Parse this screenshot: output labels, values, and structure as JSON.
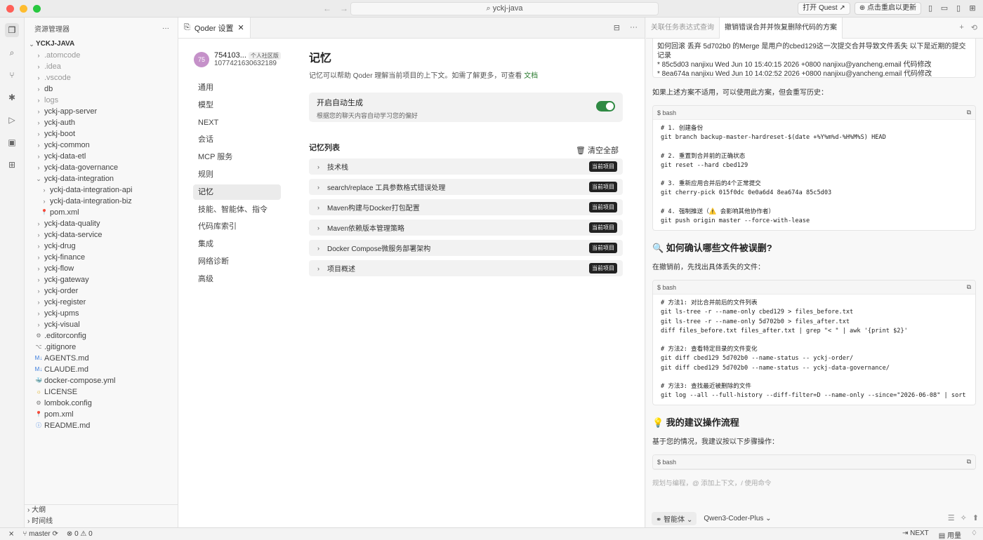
{
  "window": {
    "title": "yckj-java"
  },
  "titlebar": {
    "open_quest": "打开 Quest",
    "restart_update": "点击重启以更新"
  },
  "explorer": {
    "header": "资源管理器",
    "more": "···",
    "root": "YCKJ-JAVA",
    "items": [
      {
        "label": ".atomcode",
        "kind": "folder",
        "depth": 1,
        "dim": true
      },
      {
        "label": ".idea",
        "kind": "folder",
        "depth": 1,
        "dim": true
      },
      {
        "label": ".vscode",
        "kind": "folder",
        "depth": 1,
        "dim": true
      },
      {
        "label": "db",
        "kind": "folder",
        "depth": 1,
        "dim": false
      },
      {
        "label": "logs",
        "kind": "folder",
        "depth": 1,
        "dim": true
      },
      {
        "label": "yckj-app-server",
        "kind": "folder",
        "depth": 1,
        "dim": false
      },
      {
        "label": "yckj-auth",
        "kind": "folder",
        "depth": 1,
        "dim": false
      },
      {
        "label": "yckj-boot",
        "kind": "folder",
        "depth": 1,
        "dim": false
      },
      {
        "label": "yckj-common",
        "kind": "folder",
        "depth": 1,
        "dim": false
      },
      {
        "label": "yckj-data-etl",
        "kind": "folder",
        "depth": 1,
        "dim": false
      },
      {
        "label": "yckj-data-governance",
        "kind": "folder",
        "depth": 1,
        "dim": false
      },
      {
        "label": "yckj-data-integration",
        "kind": "folder-open",
        "depth": 1,
        "dim": false
      },
      {
        "label": "yckj-data-integration-api",
        "kind": "folder",
        "depth": 2,
        "dim": false
      },
      {
        "label": "yckj-data-integration-biz",
        "kind": "folder",
        "depth": 2,
        "dim": false
      },
      {
        "label": "pom.xml",
        "kind": "maven",
        "depth": 2,
        "dim": false
      },
      {
        "label": "yckj-data-quality",
        "kind": "folder",
        "depth": 1,
        "dim": false
      },
      {
        "label": "yckj-data-service",
        "kind": "folder",
        "depth": 1,
        "dim": false
      },
      {
        "label": "yckj-drug",
        "kind": "folder",
        "depth": 1,
        "dim": false
      },
      {
        "label": "yckj-finance",
        "kind": "folder",
        "depth": 1,
        "dim": false
      },
      {
        "label": "yckj-flow",
        "kind": "folder",
        "depth": 1,
        "dim": false
      },
      {
        "label": "yckj-gateway",
        "kind": "folder",
        "depth": 1,
        "dim": false
      },
      {
        "label": "yckj-order",
        "kind": "folder",
        "depth": 1,
        "dim": false
      },
      {
        "label": "yckj-register",
        "kind": "folder",
        "depth": 1,
        "dim": false
      },
      {
        "label": "yckj-upms",
        "kind": "folder",
        "depth": 1,
        "dim": false
      },
      {
        "label": "yckj-visual",
        "kind": "folder",
        "depth": 1,
        "dim": false
      },
      {
        "label": ".editorconfig",
        "kind": "gear",
        "depth": 1,
        "dim": false
      },
      {
        "label": ".gitignore",
        "kind": "git",
        "depth": 1,
        "dim": false
      },
      {
        "label": "AGENTS.md",
        "kind": "md",
        "depth": 1,
        "dim": false
      },
      {
        "label": "CLAUDE.md",
        "kind": "md",
        "depth": 1,
        "dim": false
      },
      {
        "label": "docker-compose.yml",
        "kind": "docker",
        "depth": 1,
        "dim": false
      },
      {
        "label": "LICENSE",
        "kind": "license",
        "depth": 1,
        "dim": false
      },
      {
        "label": "lombok.config",
        "kind": "gear",
        "depth": 1,
        "dim": false
      },
      {
        "label": "pom.xml",
        "kind": "maven",
        "depth": 1,
        "dim": false
      },
      {
        "label": "README.md",
        "kind": "info",
        "depth": 1,
        "dim": false
      }
    ],
    "outline": "大纲",
    "timeline": "时间线"
  },
  "editor": {
    "tab_label": "Qoder 设置",
    "profile": {
      "avatar": "75",
      "name": "754103...",
      "badge": "个人社区版",
      "id": "1077421630632189"
    },
    "nav": [
      {
        "label": "通用",
        "active": false
      },
      {
        "label": "模型",
        "active": false
      },
      {
        "label": "NEXT",
        "active": false
      },
      {
        "label": "会话",
        "active": false
      },
      {
        "label": "MCP 服务",
        "active": false
      },
      {
        "label": "规则",
        "active": false
      },
      {
        "label": "记忆",
        "active": true
      },
      {
        "label": "技能、智能体、指令",
        "active": false
      },
      {
        "label": "代码库索引",
        "active": false
      },
      {
        "label": "集成",
        "active": false
      },
      {
        "label": "网络诊断",
        "active": false
      },
      {
        "label": "高级",
        "active": false
      }
    ],
    "memory": {
      "title": "记忆",
      "desc": "记忆可以帮助 Qoder 理解当前项目的上下文。如需了解更多，可查看",
      "doc_link": "文档",
      "auto_title": "开启自动生成",
      "auto_desc": "根据您的聊天内容自动学习您的偏好",
      "auto_enabled": true,
      "list_title": "记忆列表",
      "clear_all": "清空全部",
      "badge": "当前项目",
      "items": [
        "技术栈",
        "search/replace 工具参数格式错误处理",
        "Maven构建与Docker打包配置",
        "Maven依赖版本管理策略",
        "Docker Compose微服务部署架构",
        "项目概述"
      ]
    }
  },
  "chat": {
    "tabs": [
      {
        "label": "关联任务表达式查询",
        "active": false
      },
      {
        "label": "撤销错误合并并恢复删除代码的方案",
        "active": true
      }
    ],
    "quote_lines": [
      "如何回滚 丢弃 5d702b0 的Merge  是用户的cbed129这一次提交合并导致文件丢失  以下是近期的提交记录",
      "* 85c5d03 nanjixu Wed Jun 10 15:40:15 2026 +0800 nanjixu@yancheng.email 代码修改",
      "* 8ea674a nanjixu Wed Jun 10 14:02:52 2026 +0800 nanjixu@yancheng.email 代码修改"
    ],
    "p1": "如果上述方案不适用，可以使用此方案，但会重写历史：",
    "code_lang": "bash",
    "code1": "# 1. 创建备份\ngit branch backup-master-hardreset-$(date +%Y%m%d-%H%M%S) HEAD\n\n# 2. 重置到合并前的正确状态\ngit reset --hard cbed129\n\n# 3. 重新应用合并后的4个正常提交\ngit cherry-pick 015f0dc 0e0a6d4 8ea674a 85c5d03\n\n# 4. 强制推送（⚠️ 会影响其他协作者）\ngit push origin master --force-with-lease",
    "h2": "🔍 如何确认哪些文件被误删?",
    "p2": "在撤销前，先找出具体丢失的文件：",
    "code2": "# 方法1: 对比合并前后的文件列表\ngit ls-tree -r --name-only cbed129 > files_before.txt\ngit ls-tree -r --name-only 5d702b0 > files_after.txt\ndiff files_before.txt files_after.txt | grep \"< \" | awk '{print $2}'\n\n# 方法2: 查看特定目录的文件变化\ngit diff cbed129 5d702b0 --name-status -- yckj-order/\ngit diff cbed129 5d702b0 --name-status -- yckj-data-governance/\n\n# 方法3: 查找最近被删除的文件\ngit log --all --full-history --diff-filter=D --name-only --since=\"2026-06-08\" | sort",
    "h3": "💡 我的建议操作流程",
    "p3": "基于您的情况，我建议按以下步骤操作：",
    "input_placeholder": "规划与编程，@ 添加上下文，/ 使用命令",
    "agent_label": "智能体",
    "model_label": "Qwen3-Coder-Plus"
  },
  "statusbar": {
    "branch": "master",
    "errors": "0",
    "warnings": "0",
    "next": "NEXT",
    "usage": "用量"
  }
}
